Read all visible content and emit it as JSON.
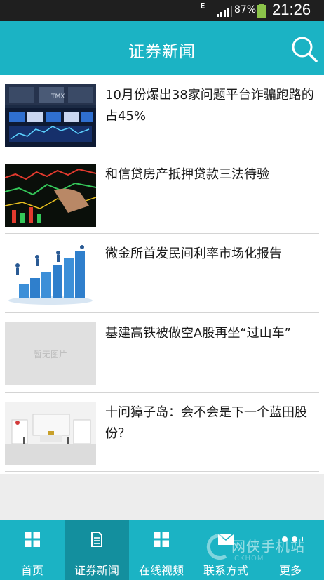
{
  "status_bar": {
    "network": "E",
    "battery_percent": "87%",
    "time": "21:26"
  },
  "header": {
    "title": "证券新闻"
  },
  "news": [
    {
      "headline": "10月份爆出38家问题平台诈骗跑路的占45%",
      "thumbnail": "stock-ticker-board"
    },
    {
      "headline": "和信贷房产抵押贷款三法待验",
      "thumbnail": "stock-chart-screen"
    },
    {
      "headline": "微金所首发民间利率市场化报告",
      "thumbnail": "business-growth-chart"
    },
    {
      "headline": "基建高铁被做空A股再坐“过山车”",
      "thumbnail": "no-image",
      "thumbnail_placeholder": "暂无图片"
    },
    {
      "headline": "十问獐子岛：会不会是下一个蓝田股份？",
      "thumbnail": "exhibition-hall"
    }
  ],
  "tabs": [
    {
      "label": "首页",
      "icon": "grid-icon",
      "active": false
    },
    {
      "label": "证券新闻",
      "icon": "document-icon",
      "active": true
    },
    {
      "label": "在线视频",
      "icon": "grid-icon",
      "active": false
    },
    {
      "label": "联系方式",
      "icon": "mail-icon",
      "active": false
    },
    {
      "label": "更多",
      "icon": "more-dots-icon",
      "active": false
    }
  ],
  "watermark": {
    "text": "网侠手机站",
    "sub": "CKHOM"
  },
  "colors": {
    "header": "#1bb3c4",
    "tab_active": "#138f9e",
    "status_bar": "#1f1f1f"
  }
}
